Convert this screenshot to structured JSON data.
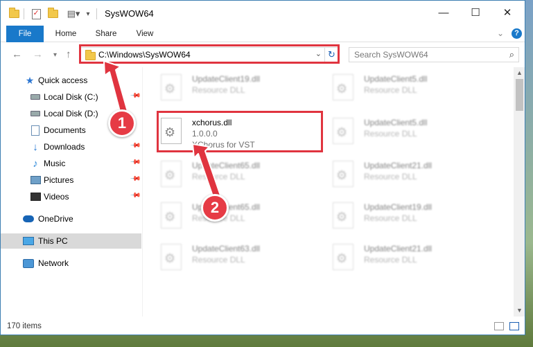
{
  "window": {
    "title": "SysWOW64",
    "minimize_icon": "minimize-icon",
    "maximize_icon": "maximize-icon",
    "close_icon": "close-icon"
  },
  "ribbon": {
    "tabs": [
      {
        "label": "File"
      },
      {
        "label": "Home"
      },
      {
        "label": "Share"
      },
      {
        "label": "View"
      }
    ],
    "help_label": "?"
  },
  "address": {
    "path": "C:\\Windows\\SysWOW64",
    "search_placeholder": "Search SysWOW64"
  },
  "sidebar": {
    "items": [
      {
        "label": "Quick access",
        "icon": "star-icon"
      },
      {
        "label": "Local Disk (C:)",
        "icon": "disk-icon"
      },
      {
        "label": "Local Disk (D:)",
        "icon": "disk-icon"
      },
      {
        "label": "Documents",
        "icon": "documents-icon"
      },
      {
        "label": "Downloads",
        "icon": "downloads-icon"
      },
      {
        "label": "Music",
        "icon": "music-icon"
      },
      {
        "label": "Pictures",
        "icon": "pictures-icon"
      },
      {
        "label": "Videos",
        "icon": "videos-icon"
      },
      {
        "label": "OneDrive",
        "icon": "cloud-icon"
      },
      {
        "label": "This PC",
        "icon": "computer-icon"
      },
      {
        "label": "Network",
        "icon": "network-icon"
      }
    ]
  },
  "files": {
    "highlighted": {
      "name": "xchorus.dll",
      "version": "1.0.0.0",
      "description": "XChorus for VST"
    },
    "tiles": [
      {
        "name": "UpdateClient19.dll",
        "type": "Resource DLL"
      },
      {
        "name": "UpdateClient5.dll",
        "type": "Resource DLL"
      },
      {
        "name": "UpdateClient5.dll",
        "type": "Resource DLL"
      },
      {
        "name": "UpdateClient65.dll",
        "type": "Resource DLL"
      },
      {
        "name": "UpdateClient21.dll",
        "type": "Resource DLL"
      },
      {
        "name": "UpdateClient65.dll",
        "type": "Resource DLL"
      },
      {
        "name": "UpdateClient19.dll",
        "type": "Resource DLL"
      },
      {
        "name": "UpdateClient63.dll",
        "type": "Resource DLL"
      },
      {
        "name": "UpdateClient21.dll",
        "type": "Resource DLL"
      }
    ]
  },
  "status": {
    "item_count": "170 items"
  },
  "annotations": {
    "step1": "1",
    "step2": "2",
    "color": "#e0343f"
  }
}
